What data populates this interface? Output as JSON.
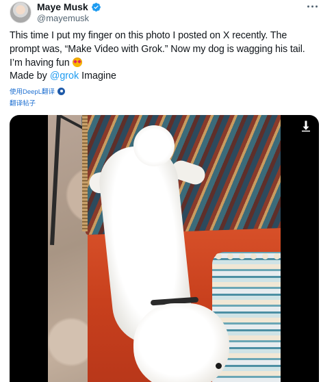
{
  "author": {
    "display_name": "Maye Musk",
    "handle": "@mayemusk",
    "verified": true
  },
  "post": {
    "text": "This time I put my finger on this photo I posted on X recently. The prompt was, “Make Video with Grok.” Now my dog is wagging his tail. I’m having fun",
    "emoji": "star-struck-emoji",
    "made_by_prefix": "Made by",
    "mention": "@grok",
    "made_by_suffix": " Imagine"
  },
  "translation": {
    "deepl_label": "使用DeepL翻译",
    "translate_post_label": "翻译帖子"
  },
  "media": {
    "type": "video",
    "icons": [
      "download-icon"
    ]
  },
  "colors": {
    "accent": "#1d9bf0",
    "verified": "#1d9bf0",
    "text": "#0f1419",
    "muted": "#536471",
    "deepl_link": "#1d6fd1"
  }
}
